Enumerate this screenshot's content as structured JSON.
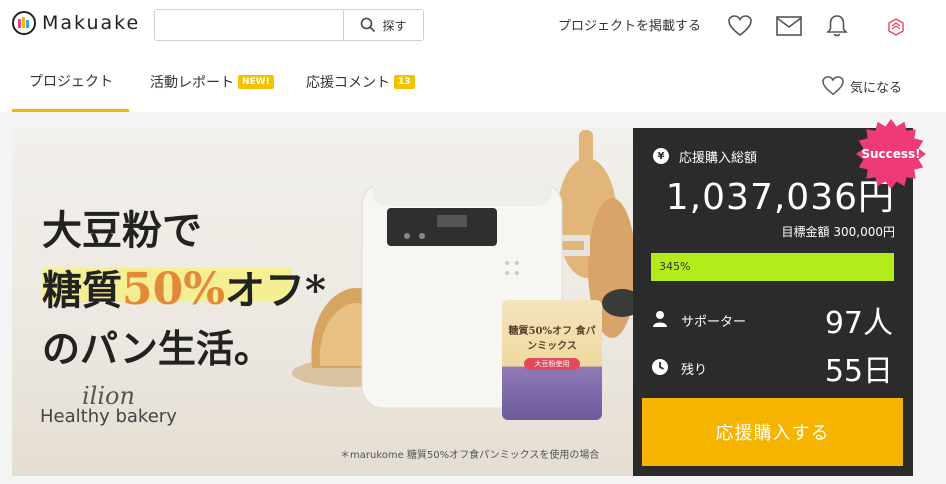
{
  "header": {
    "logo_text": "Makuake",
    "search": {
      "placeholder": "",
      "button_label": "探す"
    },
    "post_project_label": "プロジェクトを掲載する"
  },
  "tabs": [
    {
      "label": "プロジェクト",
      "badge": ""
    },
    {
      "label": "活動レポート",
      "badge": "NEW!"
    },
    {
      "label": "応援コメント",
      "badge": "13"
    }
  ],
  "favorite_label": "気になる",
  "hero": {
    "title_line1": "大豆粉で",
    "title_line2_a": "糖質",
    "title_line2_b": "50%",
    "title_line2_c": "オフ*",
    "title_line3": "のパン生活。",
    "brand": "ilion",
    "subtitle": "Healthy bakery",
    "note": "＊marukome 糖質50%オフ食パンミックスを使用の場合",
    "package_label": "糖質50%オフ 食パンミックス",
    "package_small": "大豆粉使用"
  },
  "panel": {
    "currency_icon": "¥",
    "total_label": "応援購入総額",
    "total_amount": "1,037,036円",
    "goal_text": "目標金額 300,000円",
    "progress_text": "345%",
    "progress_fraction": 1.0,
    "supporters_label": "サポーター",
    "supporters_value": "97人",
    "remaining_label": "残り",
    "remaining_value": "55日",
    "buy_label": "応援購入する",
    "success_label": "Success!"
  },
  "colors": {
    "accent": "#f6b400",
    "panel_bg": "#2b2b2b",
    "progress": "#b4eb1a",
    "success": "#ee3a78"
  }
}
